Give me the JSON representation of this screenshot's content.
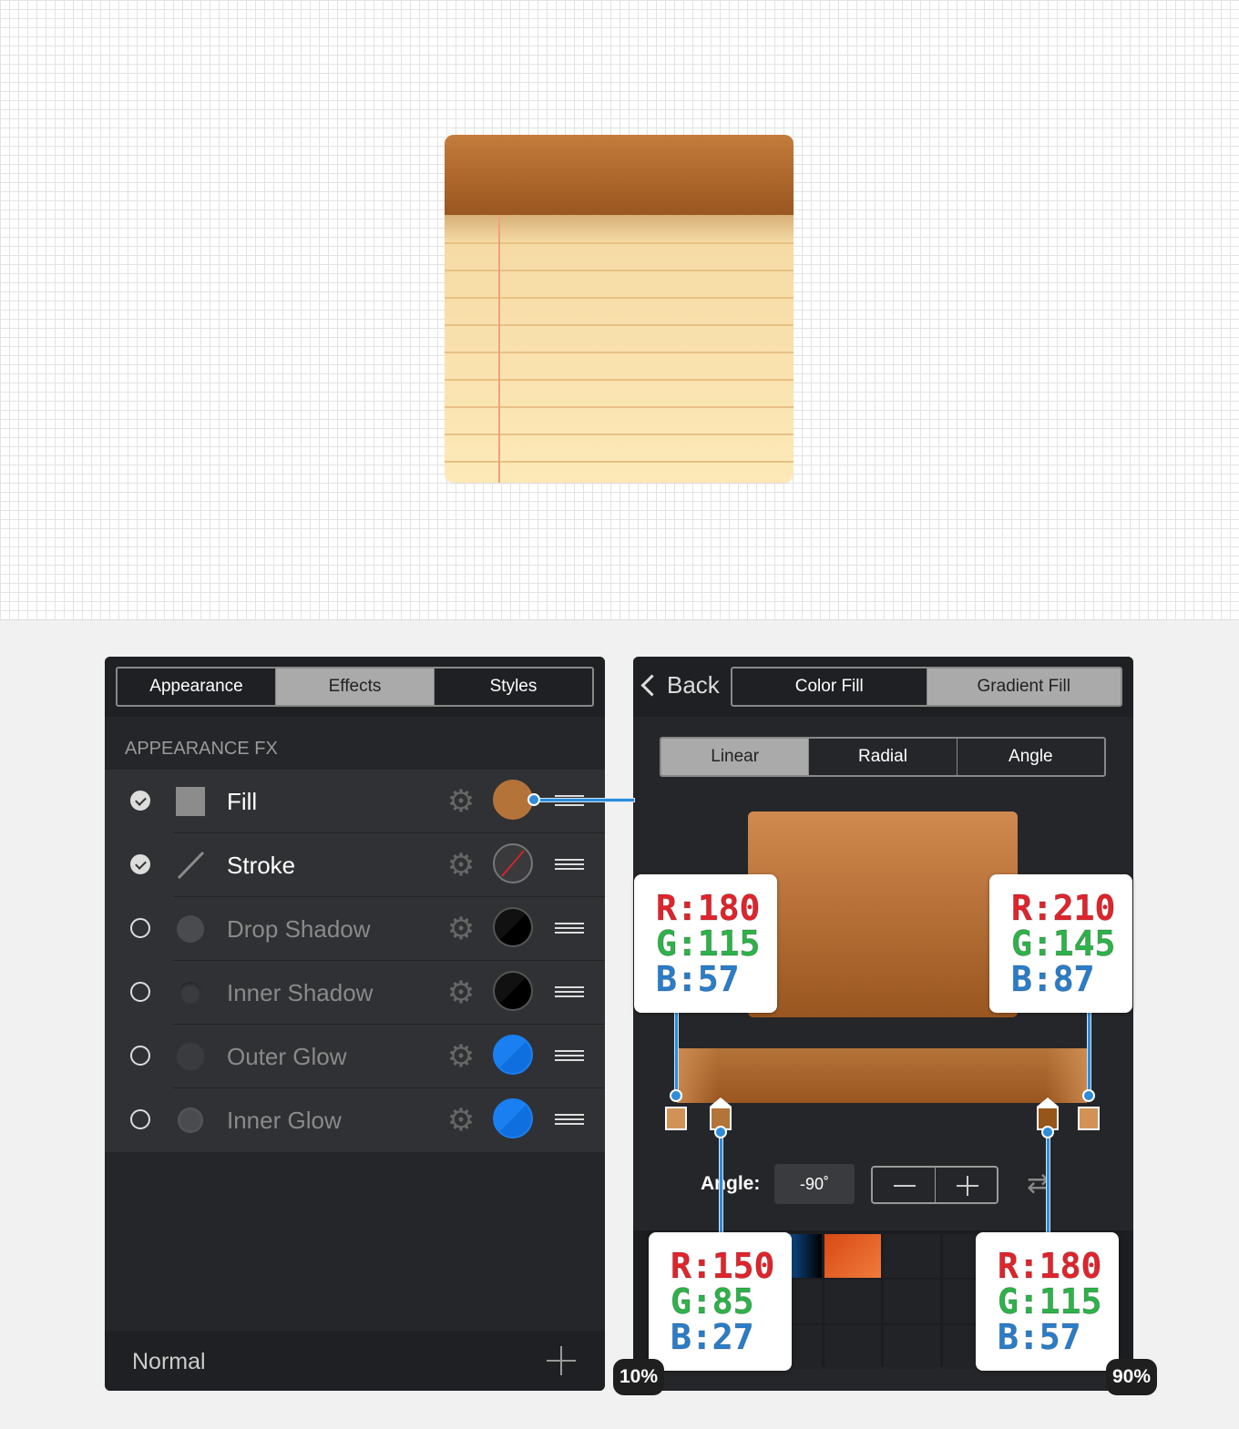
{
  "appearance_panel": {
    "tabs": [
      {
        "label": "Appearance",
        "active": false
      },
      {
        "label": "Effects",
        "active": true
      },
      {
        "label": "Styles",
        "active": false
      }
    ],
    "section_title": "APPEARANCE FX",
    "rows": [
      {
        "label": "Fill",
        "enabled": true,
        "swatch_color": "#b47339"
      },
      {
        "label": "Stroke",
        "enabled": true,
        "swatch_color": "none"
      },
      {
        "label": "Drop Shadow",
        "enabled": false,
        "swatch_color": "#000000"
      },
      {
        "label": "Inner Shadow",
        "enabled": false,
        "swatch_color": "#000000"
      },
      {
        "label": "Outer Glow",
        "enabled": false,
        "swatch_color": "#1a7ff0"
      },
      {
        "label": "Inner Glow",
        "enabled": false,
        "swatch_color": "#1a7ff0"
      }
    ],
    "blend_mode": "Normal"
  },
  "fill_panel": {
    "back_label": "Back",
    "fill_tabs": [
      {
        "label": "Color Fill",
        "active": false
      },
      {
        "label": "Gradient Fill",
        "active": true
      }
    ],
    "gradient_types": [
      {
        "label": "Linear",
        "active": true
      },
      {
        "label": "Radial",
        "active": false
      },
      {
        "label": "Angle",
        "active": false
      }
    ],
    "angle_label": "Angle:",
    "angle_value": "-90˚",
    "gradient_stops": [
      {
        "color": "#d29157",
        "position": 0
      },
      {
        "color": "#b47339",
        "position": 10
      },
      {
        "color": "#965519",
        "position": 90
      },
      {
        "color": "#d29157",
        "position": 100
      }
    ]
  },
  "annotations": {
    "callouts": [
      {
        "r": "R:180",
        "g": "G:115",
        "b": "B:57"
      },
      {
        "r": "R:210",
        "g": "G:145",
        "b": "B:87"
      },
      {
        "r": "R:150",
        "g": "G:85",
        "b": "B:27"
      },
      {
        "r": "R:180",
        "g": "G:115",
        "b": "B:57"
      }
    ],
    "pct_left": "10%",
    "pct_right": "90%"
  },
  "colors": {
    "panel_bg": "#252629",
    "accent_blue": "#2e8cd8",
    "notepad_header": "#b47339",
    "notepad_paper": "#fde9b8"
  }
}
